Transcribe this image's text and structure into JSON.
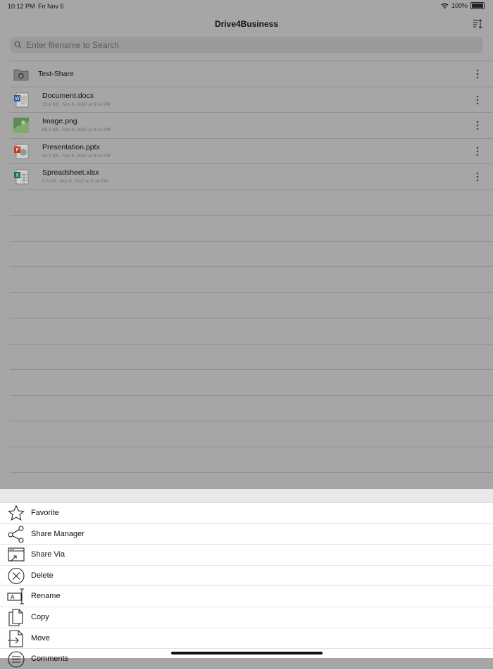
{
  "status": {
    "time": "10:12 PM",
    "date": "Fri Nov 6",
    "battery": "100%"
  },
  "nav": {
    "title": "Drive4Business"
  },
  "search": {
    "placeholder": "Enter filename to Search"
  },
  "files": [
    {
      "name": "Test-Share",
      "type": "folder",
      "meta": ""
    },
    {
      "name": "Document.docx",
      "type": "docx",
      "meta": "13.1 KB , Nov 6, 2020 at 8:14 PM"
    },
    {
      "name": "Image.png",
      "type": "png",
      "meta": "89.2 KB , Nov 6, 2020 at 8:14 PM"
    },
    {
      "name": "Presentation.pptx",
      "type": "pptx",
      "meta": "30.7 KB , Nov 6, 2020 at 8:14 PM"
    },
    {
      "name": "Spreadsheet.xlsx",
      "type": "xlsx",
      "meta": "9.5 KB , Nov 6, 2020 at 8:14 PM"
    }
  ],
  "actions": [
    {
      "label": "Favorite",
      "icon": "star-icon"
    },
    {
      "label": "Share Manager",
      "icon": "share-nodes-icon"
    },
    {
      "label": "Share Via",
      "icon": "share-via-icon"
    },
    {
      "label": "Delete",
      "icon": "delete-circle-x-icon"
    },
    {
      "label": "Rename",
      "icon": "rename-icon"
    },
    {
      "label": "Copy",
      "icon": "copy-icon"
    },
    {
      "label": "Move",
      "icon": "move-icon"
    },
    {
      "label": "Comments",
      "icon": "comments-icon"
    }
  ],
  "colors": {
    "dim_overlay": "#a6a6a6",
    "sheet_bg": "#ffffff",
    "word": "#2b5797",
    "powerpoint": "#c43e1c",
    "excel": "#1e7145"
  }
}
